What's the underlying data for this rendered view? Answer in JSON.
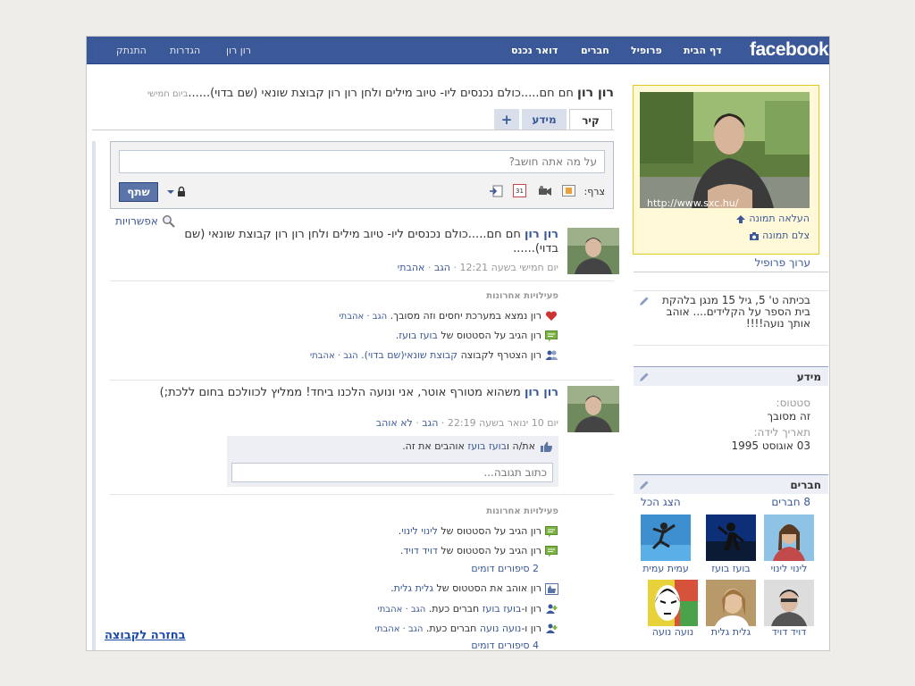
{
  "topbar": {
    "logo": "facebook",
    "home": "דף הבית",
    "profile": "פרופיל",
    "friends": "חברים",
    "inbox": "דואר נכנס",
    "user": "רון רון",
    "settings": "הגדרות",
    "logout": "התנתק"
  },
  "profile": {
    "name": "רון רון",
    "status_text": "חם חם.....כולם נכנסים ליו- טיוב מילים ולחן רון רון קבוצת שונאי (שם בדוי)......",
    "status_time": "ביום חמישי"
  },
  "tabs": {
    "wall": "קיר",
    "info": "מידע",
    "add": "+"
  },
  "composer": {
    "placeholder": "על מה אתה חושב?",
    "attach_label": "צרף:",
    "share": "שתף"
  },
  "options": "אפשרויות",
  "post1": {
    "author": "רון רון",
    "text": "חם חם.....כולם נכנסים ליו- טיוב מילים ולחן רון רון קבוצת שונאי (שם בדוי)......",
    "time": "יום חמישי בשעה 12:21",
    "comment": "הגב",
    "like": "אהבתי",
    "dot": "·"
  },
  "recent1": {
    "title": "פעילויות אחרונות",
    "items": [
      {
        "text": "רון נמצא במערכת יחסים וזה מסובך.",
        "links": "הגב · אהבתי"
      },
      {
        "pre": "רון הגיב על הסטטוס של",
        "link": "בועז בועז",
        "post": "."
      },
      {
        "pre": "רון הצטרף לקבוצה",
        "link": "קבוצת שונאי(שם בדוי).",
        "links": "הגב · אהבתי"
      }
    ]
  },
  "post2": {
    "author": "רון רון",
    "text": "משהוא מטורף אוטר, אני ונועה הלכנו ביחד! ממליץ לכוולכם בחום ללכת;)",
    "time": "יום 10 ינואר בשעה 22:19",
    "comment": "הגב",
    "unlike": "לא אוהב",
    "dot": "·",
    "likes_pre": "את/ה ו",
    "likes_link": "בועז בועז",
    "likes_post": "אוהבים את זה.",
    "comment_placeholder": "כתוב תגובה..."
  },
  "recent2": {
    "title": "פעילויות אחרונות",
    "items": [
      {
        "pre": "רון הגיב על הסטטוס של",
        "link": "לינוי לינוי",
        "post": "."
      },
      {
        "pre": "רון הגיב על הסטטוס של",
        "link": "דויד דויד",
        "post": "."
      },
      {
        "more": "2 סיפורים דומים"
      },
      {
        "pre": "רון אוהב את הסטטוס של",
        "link": "גלית גלית",
        "post": "."
      },
      {
        "pre": "רון ו-",
        "link": "בועז בועז",
        "post": "חברים כעת.",
        "links": "הגב · אהבתי"
      },
      {
        "pre": "רון ו-",
        "link": "נועה נועה",
        "post": "חברים כעת.",
        "links": "הגב · אהבתי"
      },
      {
        "more": "4 סיפורים דומים"
      }
    ]
  },
  "sidebar": {
    "photo_caption": "http://www.sxc.hu/",
    "upload_photo": "העלאה תמונה",
    "take_photo": "צלם תמונה",
    "edit_profile": "ערוך פרופיל",
    "bio": "בכיתה ט' 5, גיל 15 מנגן בלהקת בית הספר על הקלידים.... אוהב אותך נועה!!!!",
    "info_title": "מידע",
    "status_label": "סטטוס:",
    "status_value": "זה מסובך",
    "birthday_label": "תאריך לידה:",
    "birthday_value": "03 אוגוסט 1995",
    "friends_title": "חברים",
    "friends_count": "8 חברים",
    "see_all": "הצג הכל",
    "friends": [
      "לינוי לינוי",
      "בועז בועז",
      "עמית עמית",
      "דויד דויד",
      "גלית גלית",
      "נועה נועה"
    ]
  },
  "back_link": "בחזרה לקבוצה"
}
